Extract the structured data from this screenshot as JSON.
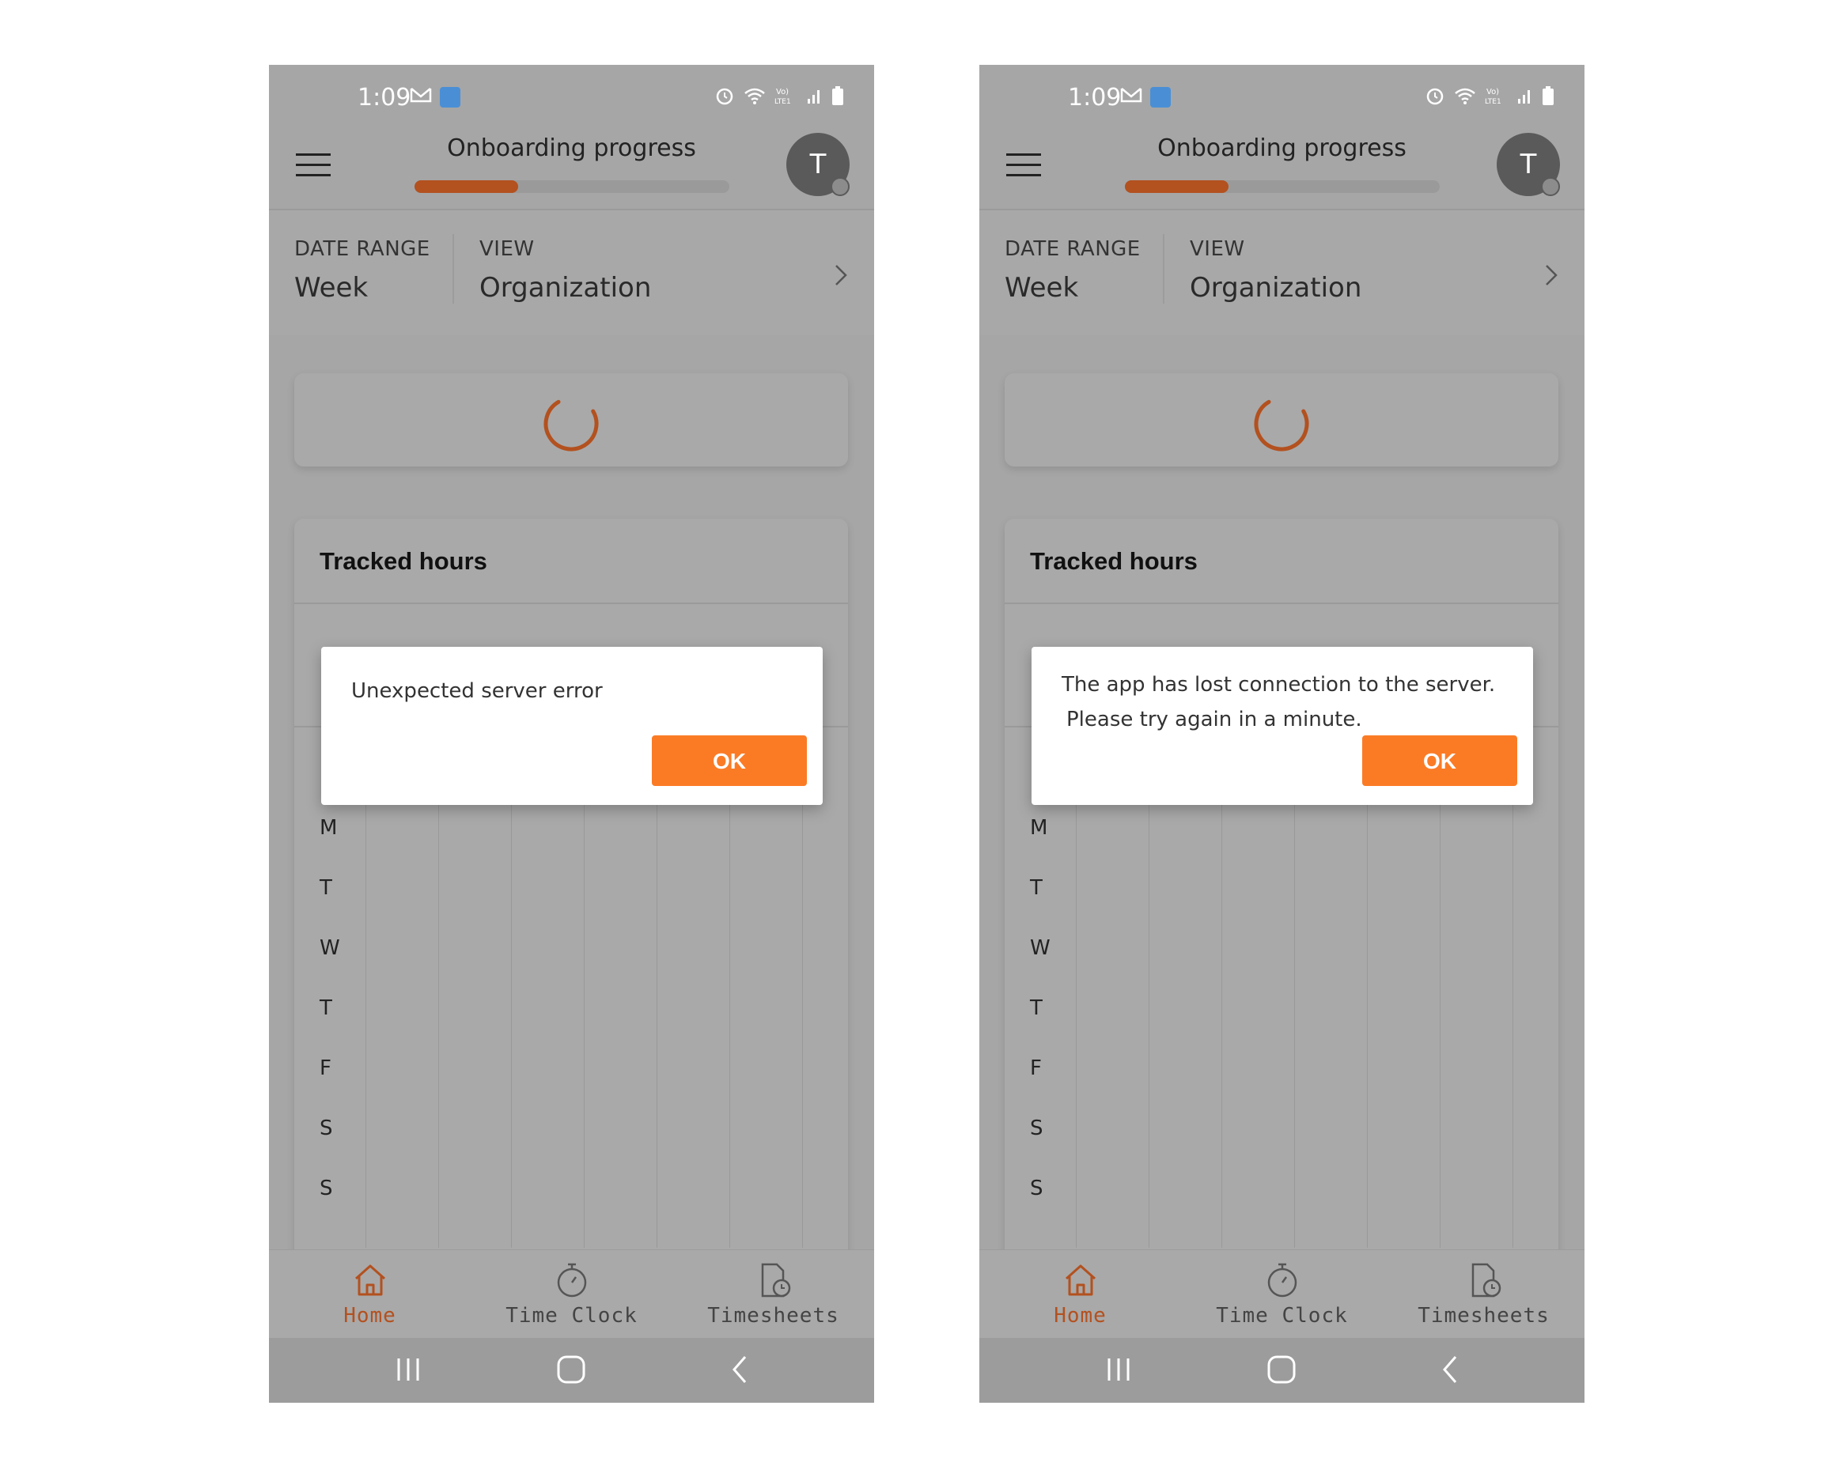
{
  "colors": {
    "accent": "#b3511f",
    "ok_button": "#fb7b25",
    "overlay_gray": "#a6a6a6"
  },
  "status_bar": {
    "time": "1:09"
  },
  "header": {
    "title": "Onboarding progress",
    "avatar_initial": "T",
    "onboarding_progress_fraction": 0.33
  },
  "filters": {
    "date_range_label": "DATE RANGE",
    "date_range_value": "Week",
    "view_label": "VIEW",
    "view_value": "Organization"
  },
  "tracked": {
    "title": "Tracked hours",
    "days": [
      "M",
      "T",
      "W",
      "T",
      "F",
      "S",
      "S"
    ]
  },
  "bottom_nav": {
    "items": [
      {
        "label": "Home",
        "icon": "home-icon",
        "active": true
      },
      {
        "label": "Time Clock",
        "icon": "stopwatch-icon",
        "active": false
      },
      {
        "label": "Timesheets",
        "icon": "timesheets-icon",
        "active": false
      }
    ]
  },
  "dialogs": {
    "left": {
      "line1": "Unexpected server error",
      "line2": "",
      "ok_label": "OK"
    },
    "right": {
      "line1": "The app has lost connection to the server.",
      "line2": "Please try again in a minute.",
      "ok_label": "OK"
    }
  }
}
